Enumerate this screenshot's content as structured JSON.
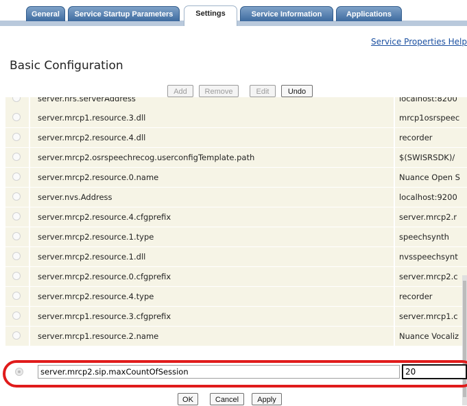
{
  "tabs": [
    "General",
    "Service Startup Parameters",
    "Settings",
    "Service Information",
    "Applications"
  ],
  "active_tab": "Settings",
  "help_link": "Service Properties Help",
  "title": "Basic Configuration",
  "toolbar": {
    "add": "Add",
    "remove": "Remove",
    "edit": "Edit",
    "undo": "Undo"
  },
  "rows": [
    {
      "name": "server.nrs.serverAddress",
      "value": "localhost:8200"
    },
    {
      "name": "server.mrcp1.resource.3.dll",
      "value": "mrcp1osrspeec"
    },
    {
      "name": "server.mrcp2.resource.4.dll",
      "value": "recorder"
    },
    {
      "name": "server.mrcp2.osrspeechrecog.userconfigTemplate.path",
      "value": "$(SWISRSDK)/"
    },
    {
      "name": "server.mrcp2.resource.0.name",
      "value": "Nuance Open S"
    },
    {
      "name": "server.nvs.Address",
      "value": "localhost:9200"
    },
    {
      "name": "server.mrcp2.resource.4.cfgprefix",
      "value": "server.mrcp2.r"
    },
    {
      "name": "server.mrcp2.resource.1.type",
      "value": "speechsynth"
    },
    {
      "name": "server.mrcp2.resource.1.dll",
      "value": "nvsspeechsynt"
    },
    {
      "name": "server.mrcp2.resource.0.cfgprefix",
      "value": "server.mrcp2.c"
    },
    {
      "name": "server.mrcp2.resource.4.type",
      "value": "recorder"
    },
    {
      "name": "server.mrcp1.resource.3.cfgprefix",
      "value": "server.mrcp1.c"
    },
    {
      "name": "server.mrcp1.resource.2.name",
      "value": "Nuance Vocaliz"
    }
  ],
  "edit_row": {
    "name": "server.mrcp2.sip.maxCountOfSession",
    "value": "20"
  },
  "footer": {
    "ok": "OK",
    "cancel": "Cancel",
    "apply": "Apply"
  }
}
